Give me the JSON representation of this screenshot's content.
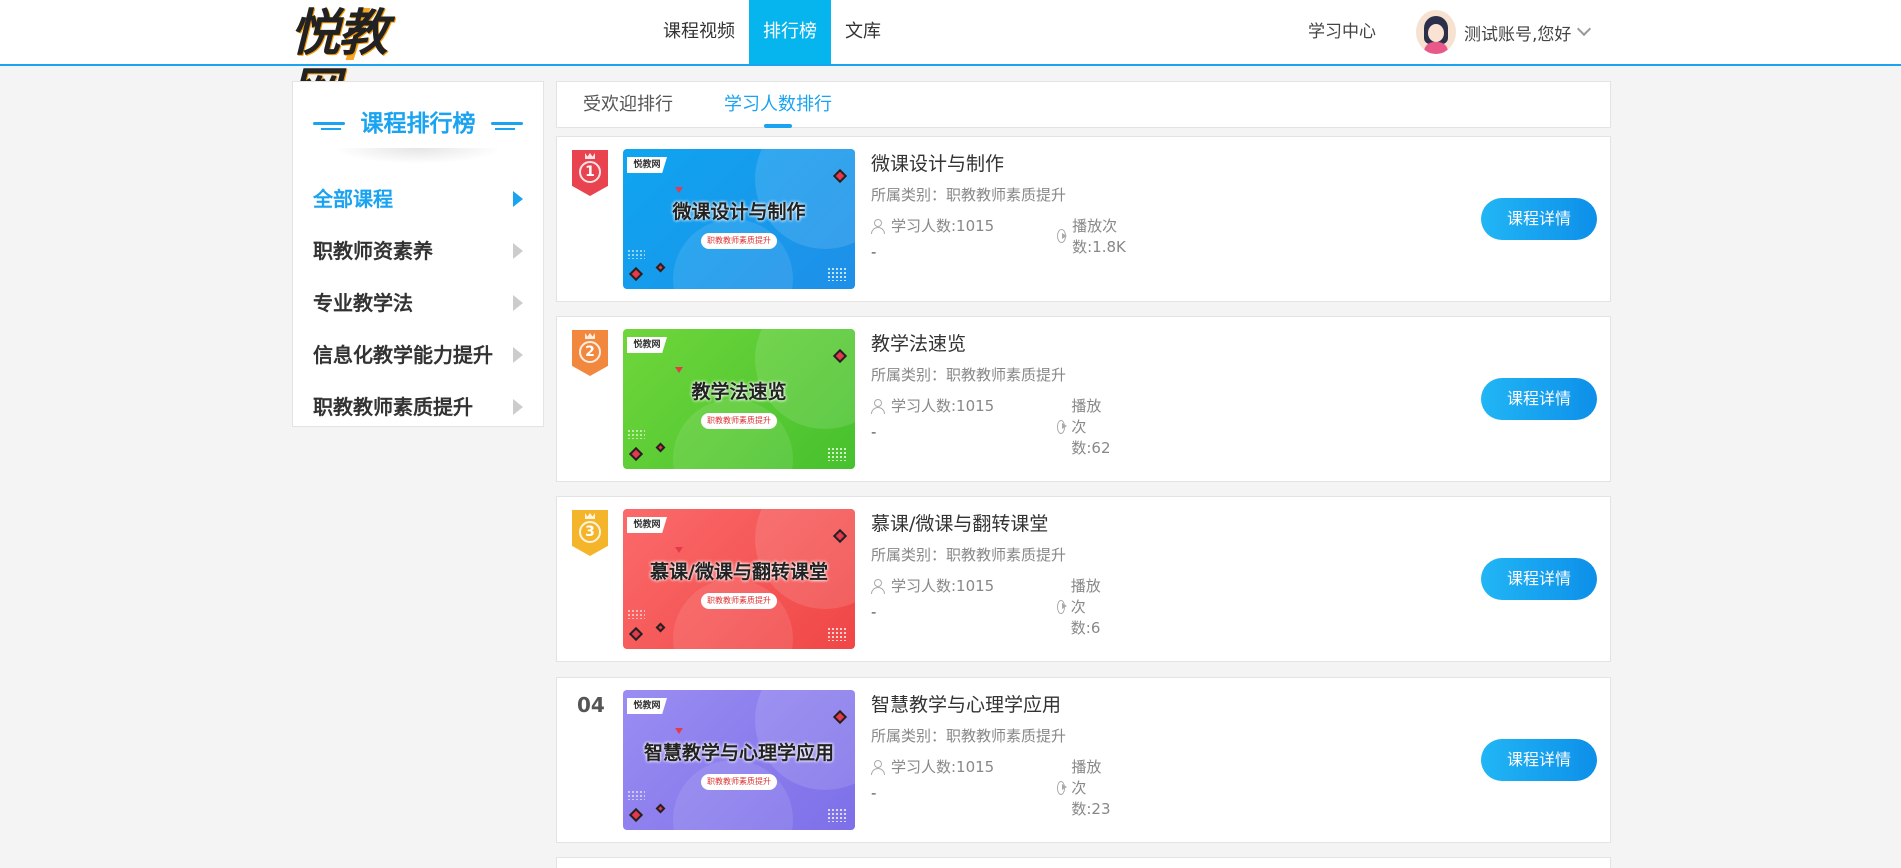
{
  "header": {
    "logo_text": "悦教网",
    "nav": [
      "课程视频",
      "排行榜",
      "文库"
    ],
    "nav_active": 1,
    "study_center": "学习中心",
    "user_name": "测试账号,您好"
  },
  "sidebar": {
    "title": "课程排行榜",
    "items": [
      {
        "label": "全部课程",
        "active": true
      },
      {
        "label": "职教师资素养",
        "active": false
      },
      {
        "label": "专业教学法",
        "active": false
      },
      {
        "label": "信息化教学能力提升",
        "active": false
      },
      {
        "label": "职教教师素质提升",
        "active": false
      }
    ]
  },
  "tabs": [
    {
      "label": "受欢迎排行",
      "active": false
    },
    {
      "label": "学习人数排行",
      "active": true
    }
  ],
  "courses": [
    {
      "rank": "1",
      "badge_color": "#e8434f",
      "thumb_color": "#1f8fe8",
      "thumb_color2": "#0ea5f0",
      "thumb_tag": "悦教网",
      "thumb_pill": "职教教师素质提升",
      "title": "微课设计与制作",
      "category_label": "所属类别：",
      "category": "职教教师素质提升",
      "learners": "学习人数:1015",
      "plays": "播放次数:1.8K",
      "desc": "-",
      "button": "课程详情"
    },
    {
      "rank": "2",
      "badge_color": "#f2883e",
      "thumb_color": "#46c12e",
      "thumb_color2": "#6fd63b",
      "thumb_tag": "悦教网",
      "thumb_pill": "职教教师素质提升",
      "title": "教学法速览",
      "category_label": "所属类别：",
      "category": "职教教师素质提升",
      "learners": "学习人数:1015",
      "plays": "播放次数:62",
      "desc": "-",
      "button": "课程详情"
    },
    {
      "rank": "3",
      "badge_color": "#f5b52a",
      "thumb_color": "#f04646",
      "thumb_color2": "#fb6a6a",
      "thumb_tag": "悦教网",
      "thumb_pill": "职教教师素质提升",
      "title": "慕课/微课与翻转课堂",
      "category_label": "所属类别：",
      "category": "职教教师素质提升",
      "learners": "学习人数:1015",
      "plays": "播放次数:6",
      "desc": "-",
      "button": "课程详情"
    },
    {
      "rank": "04",
      "badge_color": "",
      "thumb_color": "#7d6fe8",
      "thumb_color2": "#9a8df2",
      "thumb_tag": "悦教网",
      "thumb_pill": "职教教师素质提升",
      "title": "智慧教学与心理学应用",
      "category_label": "所属类别：",
      "category": "职教教师素质提升",
      "learners": "学习人数:1015",
      "plays": "播放次数:23",
      "desc": "-",
      "button": "课程详情"
    }
  ]
}
